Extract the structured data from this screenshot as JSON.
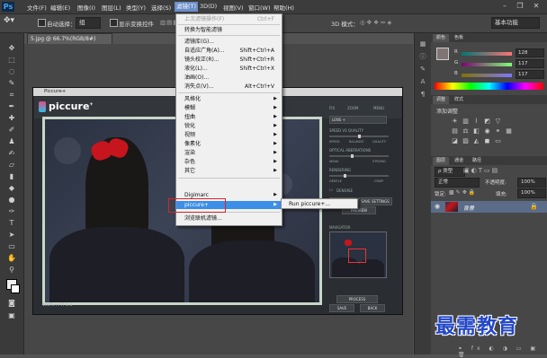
{
  "app": {
    "logo": "Ps"
  },
  "menubar": {
    "items": [
      "文件(F)",
      "编辑(E)",
      "图像(I)",
      "图层(L)",
      "类型(Y)",
      "选择(S)",
      "滤镜(T)",
      "3D(D)",
      "视图(V)",
      "窗口(W)",
      "帮助(H)"
    ]
  },
  "window_controls": {
    "minimize": "–",
    "restore": "❐",
    "close": "✕"
  },
  "options_bar": {
    "auto_select_label": "自动选择：",
    "auto_select_value": "组",
    "show_transform_label": "显示变换控件",
    "mode_3d_label": "3D 模式：",
    "workspace": "基本功能"
  },
  "document_tab": {
    "label": "5.jpg @ 66.7%(RGB/8#)"
  },
  "filter_menu": {
    "items": [
      {
        "label": "上次滤镜操作(F)",
        "shortcut": "Ctrl+F",
        "disabled": true
      },
      {
        "label": "转换为智能滤镜",
        "shortcut": ""
      },
      {
        "label": "滤镜库(G)...",
        "shortcut": ""
      },
      {
        "label": "自适应广角(A)...",
        "shortcut": "Shift+Ctrl+A"
      },
      {
        "label": "镜头校正(R)...",
        "shortcut": "Shift+Ctrl+R"
      },
      {
        "label": "液化(L)...",
        "shortcut": "Shift+Ctrl+X"
      },
      {
        "label": "油画(O)...",
        "shortcut": ""
      },
      {
        "label": "消失点(V)...",
        "shortcut": "Alt+Ctrl+V"
      },
      {
        "label": "风格化",
        "submenu": true
      },
      {
        "label": "模糊",
        "submenu": true
      },
      {
        "label": "扭曲",
        "submenu": true
      },
      {
        "label": "锐化",
        "submenu": true
      },
      {
        "label": "视频",
        "submenu": true
      },
      {
        "label": "像素化",
        "submenu": true
      },
      {
        "label": "渲染",
        "submenu": true
      },
      {
        "label": "杂色",
        "submenu": true
      },
      {
        "label": "其它",
        "submenu": true
      },
      {
        "label": "Digimarc",
        "submenu": true
      },
      {
        "label": "piccure+",
        "submenu": true,
        "highlighted": true
      },
      {
        "label": "浏览联机滤镜...",
        "shortcut": ""
      }
    ],
    "submenu_item": "Run piccure+..."
  },
  "plugin": {
    "title": "Piccure+",
    "logo": "piccure",
    "logo_mark": "+",
    "right_panel": {
      "tabs": [
        "FIX",
        "ZOOM",
        "MENU"
      ],
      "lens_select": "LENS +",
      "section_speed": "SPEED VS QUALITY",
      "speed_opts": [
        "SPEED",
        "BALANCE",
        "QUALITY"
      ],
      "section_optical": "OPTICAL ABERRATIONS",
      "optical_opts": [
        "WEAK",
        "STRONG"
      ],
      "section_rendering": "RENDERING",
      "rendering_opts": [
        "GENTLE",
        "CRISP"
      ],
      "denoise_label": "DENOISE",
      "buttons": [
        "RESET",
        "SAVE SETTINGS",
        "PREVIEW"
      ],
      "section_navigator": "NAVIGATOR",
      "bottom_buttons": [
        "PROCESS",
        "SAVE",
        "BACK"
      ]
    },
    "bottom_bar": "100% ▾ FIT 1:1"
  },
  "panels": {
    "color_tabs": [
      "颜色",
      "色板"
    ],
    "rgb": [
      {
        "label": "R",
        "value": "128"
      },
      {
        "label": "G",
        "value": "117"
      },
      {
        "label": "B",
        "value": "117"
      }
    ],
    "adjust_tabs": [
      "调整",
      "样式"
    ],
    "adjust_title": "添加调整",
    "layer_tabs": [
      "图层",
      "通道",
      "路径"
    ],
    "layer_kind": "ρ 类型",
    "blend_mode": "正常",
    "opacity_label": "不透明度:",
    "opacity_value": "100%",
    "lock_label": "锁定:",
    "fill_label": "填充:",
    "fill_value": "100%",
    "layer_name": "背景"
  },
  "watermark": "最需教育"
}
